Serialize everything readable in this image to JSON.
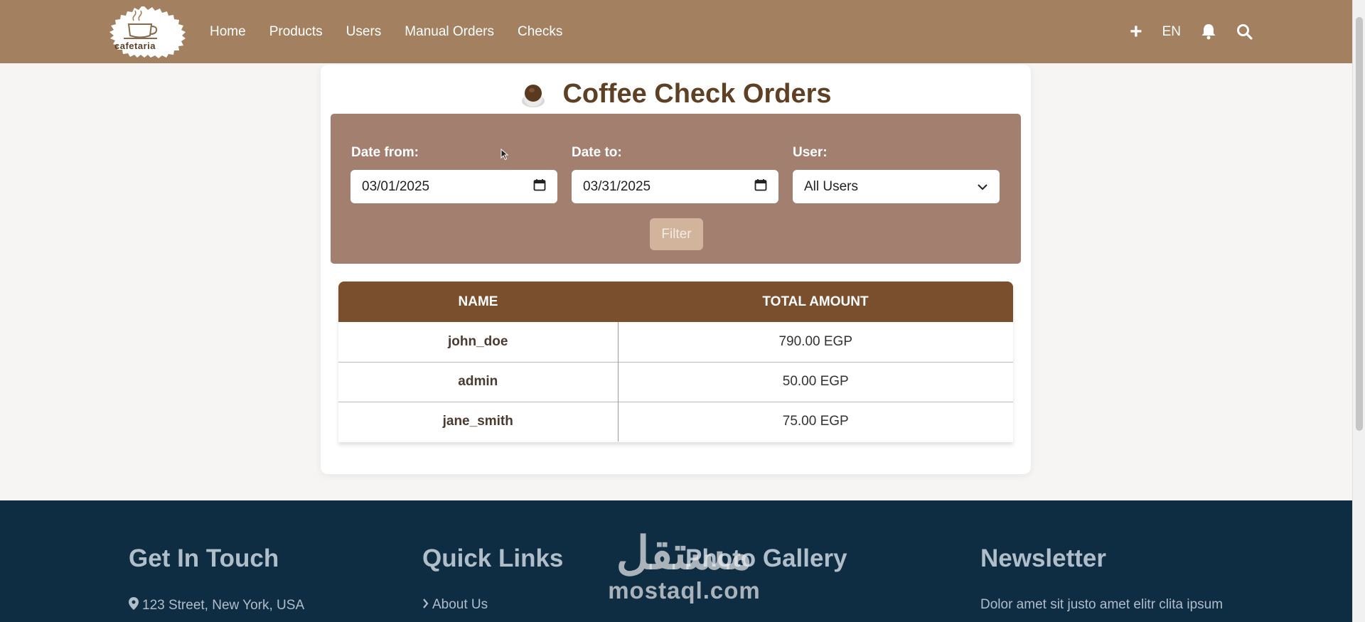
{
  "navbar": {
    "logo_text": "cafetaria",
    "links": [
      "Home",
      "Products",
      "Users",
      "Manual Orders",
      "Checks"
    ],
    "add_label": "+",
    "language": "EN",
    "icons": [
      "plus-icon",
      "bell-icon",
      "search-icon"
    ]
  },
  "page": {
    "title": "Coffee Check Orders"
  },
  "filters": {
    "date_from_label": "Date from:",
    "date_from_value": "03/01/2025",
    "date_to_label": "Date to:",
    "date_to_value": "03/31/2025",
    "user_label": "User:",
    "user_value": "All Users",
    "filter_button": "Filter"
  },
  "table": {
    "headers": [
      "NAME",
      "TOTAL AMOUNT"
    ],
    "rows": [
      {
        "name": "john_doe",
        "total": "790.00 EGP"
      },
      {
        "name": "admin",
        "total": "50.00 EGP"
      },
      {
        "name": "jane_smith",
        "total": "75.00 EGP"
      }
    ]
  },
  "footer": {
    "get_in_touch": "Get In Touch",
    "address": "123 Street, New York, USA",
    "quick_links": "Quick Links",
    "about_us": "About Us",
    "photo_gallery": "Photo Gallery",
    "newsletter": "Newsletter",
    "newsletter_text": "Dolor amet sit justo amet elitr clita ipsum"
  },
  "watermark": {
    "arabic": "مستقل",
    "latin": "mostaql.com"
  },
  "colors": {
    "navbar": "#a3805f",
    "filter_box": "#a27f6e",
    "table_header": "#7a4f2e",
    "title": "#5e4024",
    "footer": "#0e2d43"
  }
}
